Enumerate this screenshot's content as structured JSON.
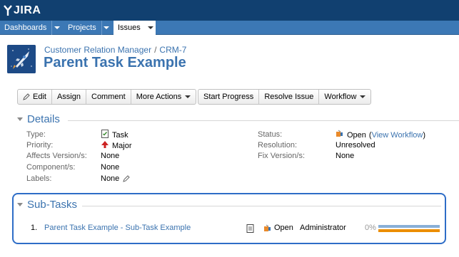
{
  "app": {
    "logo_text": "JIRA"
  },
  "nav": {
    "items": [
      {
        "label": "Dashboards"
      },
      {
        "label": "Projects"
      },
      {
        "label": "Issues",
        "active": true
      }
    ]
  },
  "issue": {
    "breadcrumb": {
      "project": "Customer Relation Manager",
      "separator": "/",
      "key": "CRM-7"
    },
    "title": "Parent Task Example"
  },
  "toolbar": {
    "group1": [
      "Edit",
      "Assign",
      "Comment",
      "More Actions"
    ],
    "group2": [
      "Start Progress",
      "Resolve Issue",
      "Workflow"
    ]
  },
  "details": {
    "heading": "Details",
    "left": [
      {
        "label": "Type:",
        "value": "Task",
        "icon": "task-icon"
      },
      {
        "label": "Priority:",
        "value": "Major",
        "icon": "priority-major-icon"
      },
      {
        "label": "Affects Version/s:",
        "value": "None"
      },
      {
        "label": "Component/s:",
        "value": "None"
      },
      {
        "label": "Labels:",
        "value": "None",
        "icon": "edit-pencil-icon"
      }
    ],
    "right": [
      {
        "label": "Status:",
        "value": "Open",
        "link_open": "(",
        "link": "View Workflow",
        "link_close": ")",
        "icon": "status-open-icon"
      },
      {
        "label": "Resolution:",
        "value": "Unresolved"
      },
      {
        "label": "Fix Version/s:",
        "value": "None"
      }
    ]
  },
  "subtasks": {
    "heading": "Sub-Tasks",
    "items": [
      {
        "number": "1.",
        "summary": "Parent Task Example - Sub-Task Example",
        "status": "Open",
        "assignee": "Administrator",
        "progress_label": "0%",
        "progress": 0
      }
    ]
  },
  "colors": {
    "header_dark": "#114070",
    "nav_blue": "#3c78b5",
    "link_blue": "#3b73af",
    "highlight_border": "#2e6dc7",
    "progress_estimate": "#89afd7",
    "progress_remaining": "#ec8e00"
  }
}
